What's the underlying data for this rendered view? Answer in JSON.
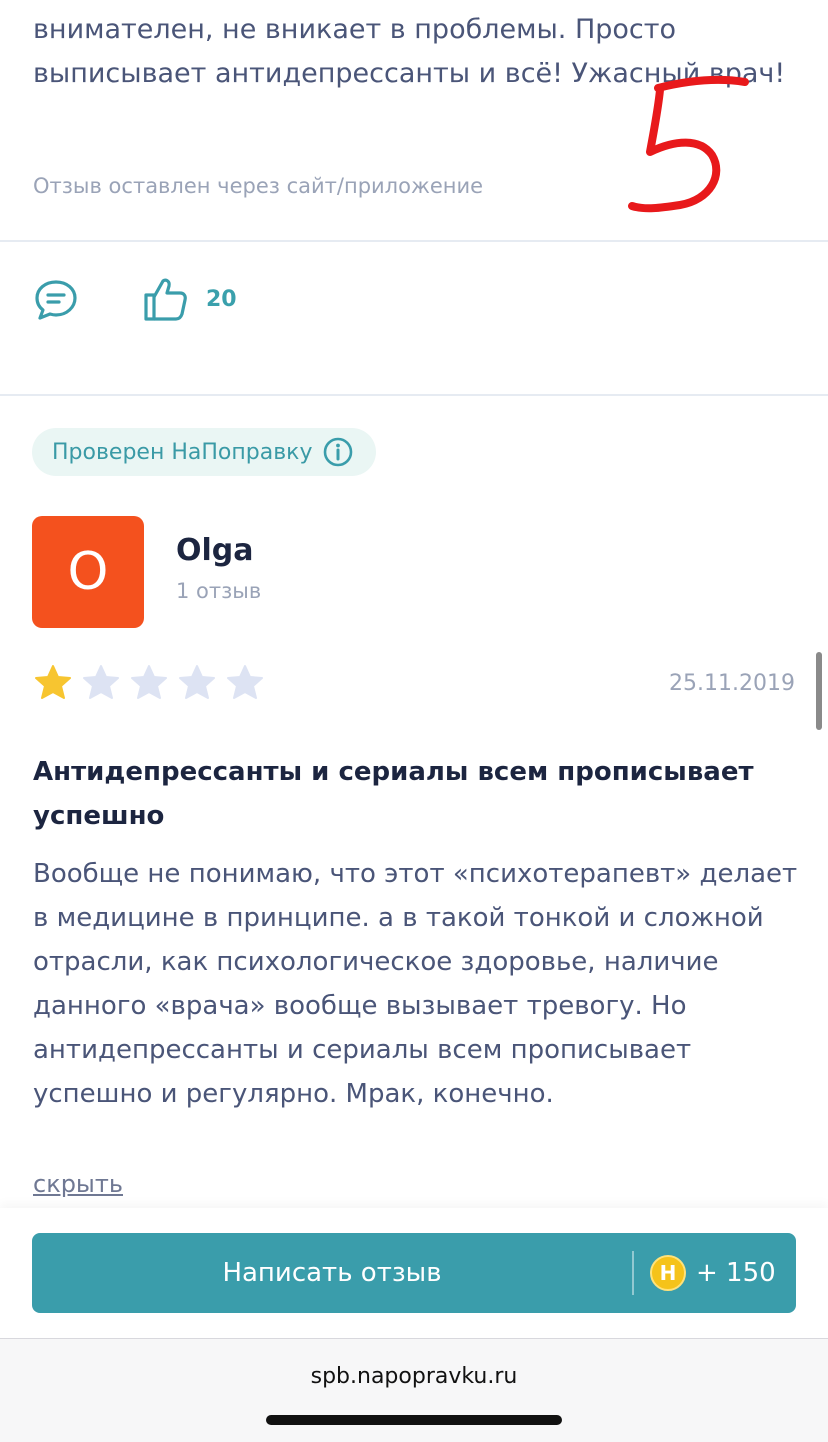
{
  "previous_review": {
    "text": "внимателен, не вникает в проблемы. Просто выписывает антидепрессанты и всё! Ужасный врач!",
    "source": "Отзыв оставлен через сайт/приложение",
    "likes": "20"
  },
  "review": {
    "verified_label": "Проверен НаПоправку",
    "avatar_letter": "O",
    "author_name": "Olga",
    "author_reviews": "1 отзыв",
    "rating": 1,
    "max_rating": 5,
    "date": "25.11.2019",
    "title": "Антидепрессанты и сериалы всем прописывает успешно",
    "body": "Вообще не понимаю, что этот «психотерапевт» делает в медицине в принципе. а в такой тонкой и сложной отрасли, как психологическое здоровье, наличие данного «врача» вообще вызывает тревогу. Но антидепрессанты и сериалы всем прописывает успешно и регулярно. Мрак, конечно.",
    "collapse_label": "скрыть"
  },
  "write_review": {
    "label": "Написать отзыв",
    "coin_letter": "Н",
    "bonus": "+ 150"
  },
  "browser": {
    "url": "spb.napopravku.ru"
  },
  "icons": {
    "comment": "comment-icon",
    "like": "thumbs-up-icon",
    "info": "info-icon",
    "star": "star-icon",
    "coin": "coin-icon"
  },
  "colors": {
    "accent": "#3a9dab",
    "avatar": "#f4511e",
    "star_filled": "#f7c530",
    "star_empty": "#dde3f3",
    "hand_mark": "#e8191b"
  }
}
